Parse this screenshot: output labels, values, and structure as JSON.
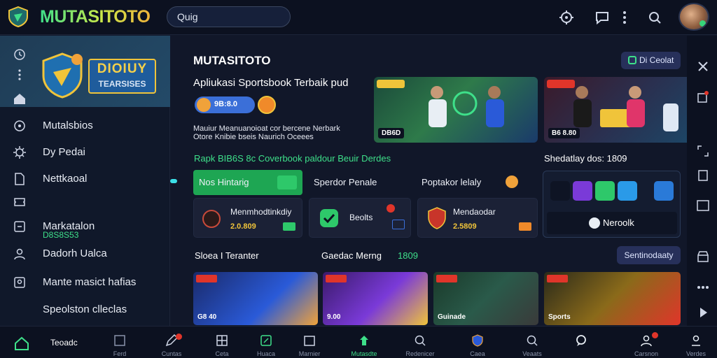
{
  "app": {
    "brand": "MUTASITOTO"
  },
  "search": {
    "value": "Quig"
  },
  "sidebar": {
    "banner": {
      "line1": "DIOIUY",
      "line2": "TEARSISES"
    },
    "items": [
      {
        "label": "Mutalsbios"
      },
      {
        "label": "Dy Pedai"
      },
      {
        "label": "Nettkaoal"
      },
      {
        "label": "Markatalon"
      },
      {
        "label": "Dadorh Ualca"
      },
      {
        "label": "Mante masict hafias"
      },
      {
        "label": "Speolston clleclas"
      }
    ],
    "sub_value": "D8S8S53"
  },
  "header": {
    "title": "MUTASITOTO",
    "subtitle": "Apliukasi Sportsbook Terbaik pud",
    "pill_text": "9B:8.0",
    "promo_text": "Mauiur Meanuanoioat cor bercene Nerbark Otore Knibie bseis Naurich Oceees",
    "tag_button": "Di Ceolat"
  },
  "heroes": [
    {
      "label": "DB6D"
    },
    {
      "label": "B6 8.80"
    }
  ],
  "section": {
    "label": "Rapk BIB6S 8c Coverbook paldour Beuir Derdes"
  },
  "tabs": [
    {
      "label": "Nos Hintarig"
    },
    {
      "label": "Sperdor Penale"
    },
    {
      "label": "Poptakor lelaly"
    }
  ],
  "cards": [
    {
      "title": "Menmhodtinkdiy",
      "value": "2.0.809"
    },
    {
      "title": "Beolts"
    },
    {
      "title": "Mendaodar",
      "value": "2.5809"
    }
  ],
  "side_panel": {
    "label": "Shedatlay dos: 1809",
    "button": "Neroolk"
  },
  "row": {
    "left_label": "Sloea I Teranter",
    "mid_label": "Gaedac Merng",
    "mid_value": "1809",
    "see_more": "Sentinodaaty"
  },
  "games": [
    {
      "label": "G8 40"
    },
    {
      "label": "9.00"
    },
    {
      "label": "Guinade"
    },
    {
      "label": "Sports"
    }
  ],
  "bottom_nav": {
    "home": "Teoadc",
    "items": [
      "Ferd",
      "Cuntas",
      "Ceta",
      "Huaca",
      "Marnier",
      "Mutasdte",
      "Redenicer",
      "Caea",
      "Veaats",
      "",
      "Carsnon",
      "Verdes"
    ]
  },
  "colors": {
    "accent": "#3ee08a",
    "active_tab": "#1ea653",
    "panel": "#1b2136"
  }
}
